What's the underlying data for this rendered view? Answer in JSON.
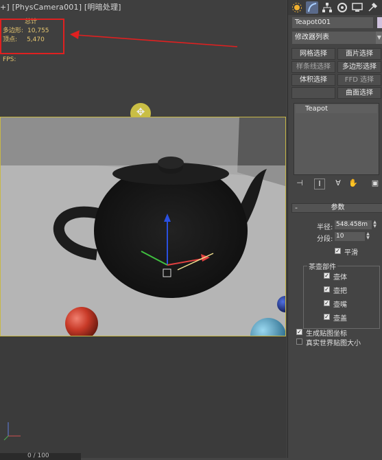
{
  "viewport": {
    "label": "+] [PhysCamera001] [明暗处理]",
    "stats": {
      "header": "总计",
      "polygons_label": "多边形:",
      "polygons_value": "10,755",
      "vertices_label": "顶点:",
      "vertices_value": "5,470"
    },
    "fps_label": "FPS:",
    "frame_counter": "0 / 100"
  },
  "colors": {
    "annotation_red": "#e02020",
    "stats_yellow": "#e8c870",
    "viewport_border": "#c8b846"
  },
  "panel": {
    "tabs": [
      "create-icon",
      "modify-icon",
      "hierarchy-icon",
      "motion-icon",
      "display-icon",
      "utilities-icon"
    ],
    "object_name": "Teapot001",
    "modifier_list": "修改器列表",
    "buttons": [
      {
        "label": "网格选择"
      },
      {
        "label": "面片选择"
      },
      {
        "label": "样条线选择"
      },
      {
        "label": "多边形选择"
      },
      {
        "label": "体积选择"
      },
      {
        "label": "FFD 选择"
      },
      {
        "label": ""
      },
      {
        "label": "曲面选择"
      }
    ],
    "stack_item": "Teapot",
    "rollout_title": "参数",
    "radius_label": "半径:",
    "radius_value": "548.458m",
    "segments_label": "分段:",
    "segments_value": "10",
    "smooth_label": "平滑",
    "parts_title": "茶壶部件",
    "parts": [
      {
        "label": "壶体"
      },
      {
        "label": "壶把"
      },
      {
        "label": "壶嘴"
      },
      {
        "label": "壶盖"
      }
    ],
    "gen_uv_label": "生成贴图坐标",
    "real_world_label": "真实世界贴图大小"
  }
}
